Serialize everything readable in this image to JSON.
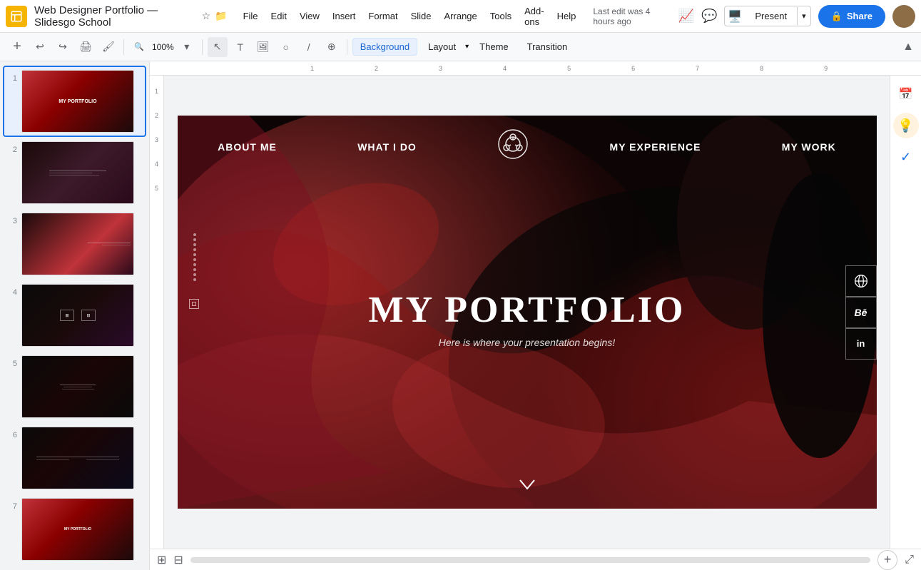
{
  "app": {
    "icon": "📄",
    "title": "Web Designer Portfolio — Slidesgo School",
    "star_icon": "☆",
    "folder_icon": "📁"
  },
  "menubar": {
    "items": [
      "File",
      "Edit",
      "View",
      "Insert",
      "Format",
      "Slide",
      "Arrange",
      "Tools",
      "Add-ons",
      "Help"
    ]
  },
  "last_edit": "Last edit was 4 hours ago",
  "toolbar": {
    "background_label": "Background",
    "layout_label": "Layout",
    "theme_label": "Theme",
    "transition_label": "Transition"
  },
  "present_btn": "Present",
  "share_btn": "Share",
  "slide_count": 7,
  "slides": [
    {
      "num": "1",
      "active": true
    },
    {
      "num": "2",
      "active": false
    },
    {
      "num": "3",
      "active": false
    },
    {
      "num": "4",
      "active": false
    },
    {
      "num": "5",
      "active": false
    },
    {
      "num": "6",
      "active": false
    },
    {
      "num": "7",
      "active": false
    }
  ],
  "current_slide": {
    "nav_items": [
      "ABOUT ME",
      "WHAT I DO",
      "MY EXPERIENCE",
      "MY WORK"
    ],
    "title": "MY PORTFOLIO",
    "subtitle": "Here is where your presentation begins!",
    "chevron": "∨"
  },
  "side_icons": [
    "⊕",
    "Bē",
    "in"
  ],
  "ruler": {
    "h_ticks": [
      "1",
      "2",
      "3",
      "4",
      "5",
      "6",
      "7",
      "8",
      "9"
    ],
    "v_ticks": [
      "1",
      "2",
      "3",
      "4",
      "5"
    ]
  }
}
